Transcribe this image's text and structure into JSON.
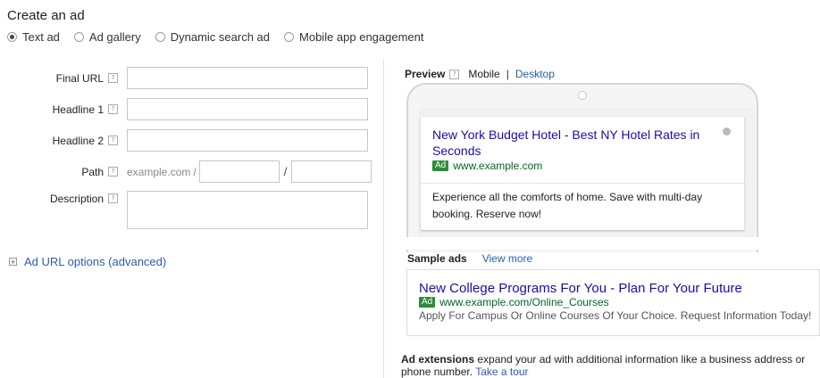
{
  "page": {
    "title": "Create an ad"
  },
  "ad_types": [
    {
      "label": "Text ad",
      "selected": true
    },
    {
      "label": "Ad gallery",
      "selected": false
    },
    {
      "label": "Dynamic search ad",
      "selected": false
    },
    {
      "label": "Mobile app engagement",
      "selected": false
    }
  ],
  "form": {
    "final_url": {
      "label": "Final URL",
      "value": ""
    },
    "headline1": {
      "label": "Headline 1",
      "value": ""
    },
    "headline2": {
      "label": "Headline 2",
      "value": ""
    },
    "path": {
      "label": "Path",
      "prefix": "example.com",
      "slash1": "/",
      "slash2": "/",
      "value1": "",
      "value2": ""
    },
    "description": {
      "label": "Description",
      "value": ""
    },
    "help_glyph": "?"
  },
  "url_options": {
    "expand_glyph": "+",
    "label": "Ad URL options (advanced)"
  },
  "preview": {
    "label": "Preview",
    "mobile": "Mobile",
    "separator": "|",
    "desktop": "Desktop",
    "ad": {
      "headline": "New York Budget Hotel - Best NY Hotel Rates in Seconds",
      "badge": "Ad",
      "display_url": "www.example.com",
      "description": "Experience all the comforts of home. Save with multi-day booking. Reserve now!"
    }
  },
  "sample_ads": {
    "label": "Sample ads",
    "view_more": "View more",
    "ad": {
      "headline": "New College Programs For You - Plan For Your Future",
      "badge": "Ad",
      "display_url": "www.example.com/Online_Courses",
      "description": "Apply For Campus Or Online Courses Of Your Choice. Request Information Today!"
    }
  },
  "extensions": {
    "bold": "Ad extensions",
    "text": " expand your ad with additional information like a business address or phone number. ",
    "link": "Take a tour"
  },
  "colors": {
    "link": "#2a5db0",
    "ad_headline": "#1a0dab",
    "ad_url": "#006621",
    "ad_badge": "#2e8b3a"
  }
}
